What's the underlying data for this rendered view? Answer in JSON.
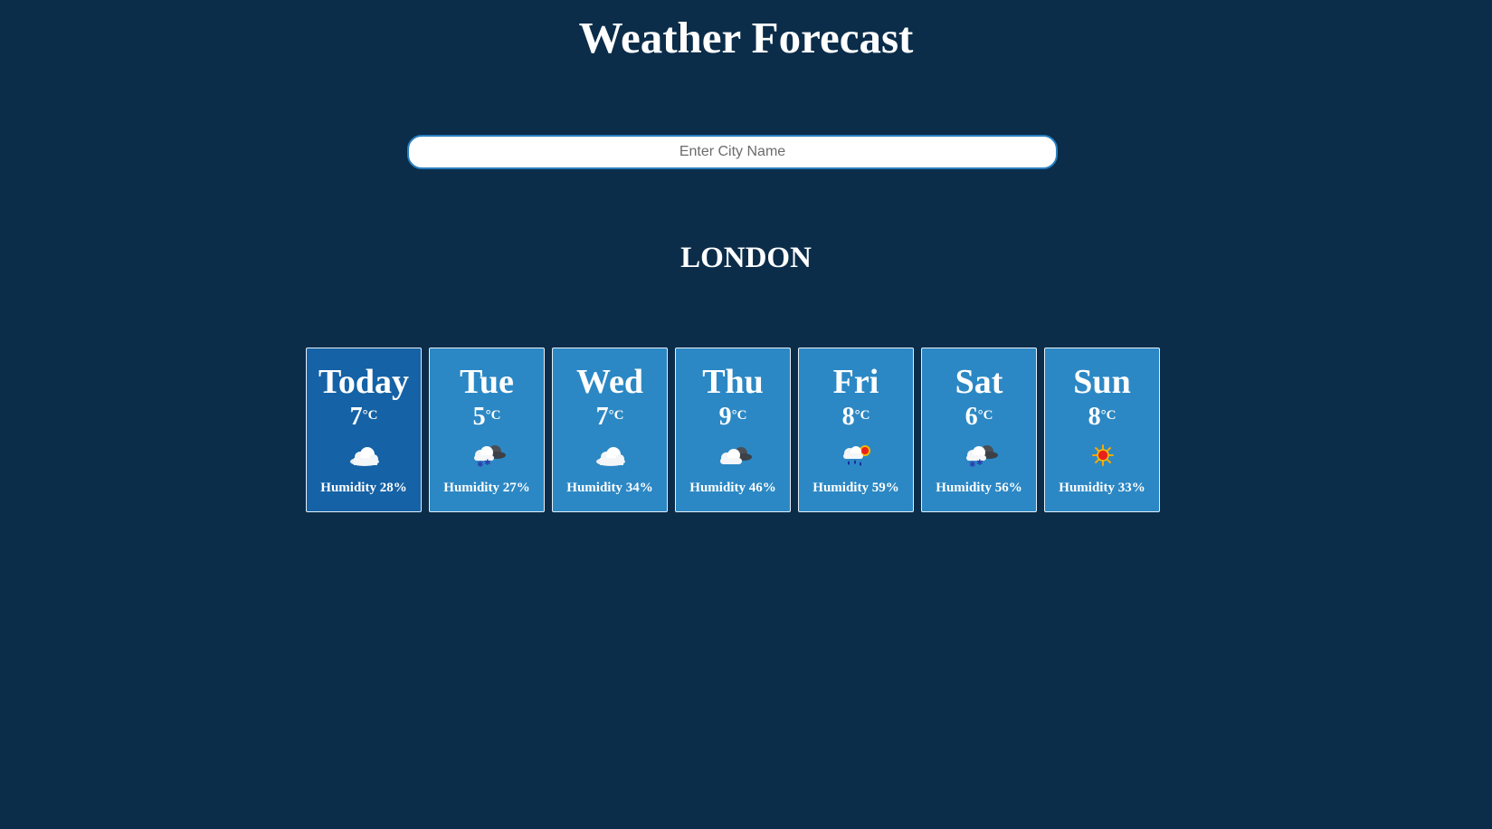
{
  "header": {
    "title": "Weather Forecast"
  },
  "search": {
    "placeholder": "Enter City Name",
    "value": ""
  },
  "city": {
    "name": "LONDON"
  },
  "temp_unit": "°C",
  "forecast": [
    {
      "day": "Today",
      "temp": "7",
      "icon": "cloud-icon",
      "humidity": "Humidity 28%"
    },
    {
      "day": "Tue",
      "temp": "5",
      "icon": "snow-cloud-icon",
      "humidity": "Humidity 27%"
    },
    {
      "day": "Wed",
      "temp": "7",
      "icon": "cloud-icon",
      "humidity": "Humidity 34%"
    },
    {
      "day": "Thu",
      "temp": "9",
      "icon": "overcast-icon",
      "humidity": "Humidity 46%"
    },
    {
      "day": "Fri",
      "temp": "8",
      "icon": "rain-sun-icon",
      "humidity": "Humidity 59%"
    },
    {
      "day": "Sat",
      "temp": "6",
      "icon": "snow-cloud-icon",
      "humidity": "Humidity 56%"
    },
    {
      "day": "Sun",
      "temp": "8",
      "icon": "sun-icon",
      "humidity": "Humidity 33%"
    }
  ],
  "colors": {
    "background": "#0b2d4a",
    "card": "#2c88c4",
    "card_today": "#1562a6"
  }
}
